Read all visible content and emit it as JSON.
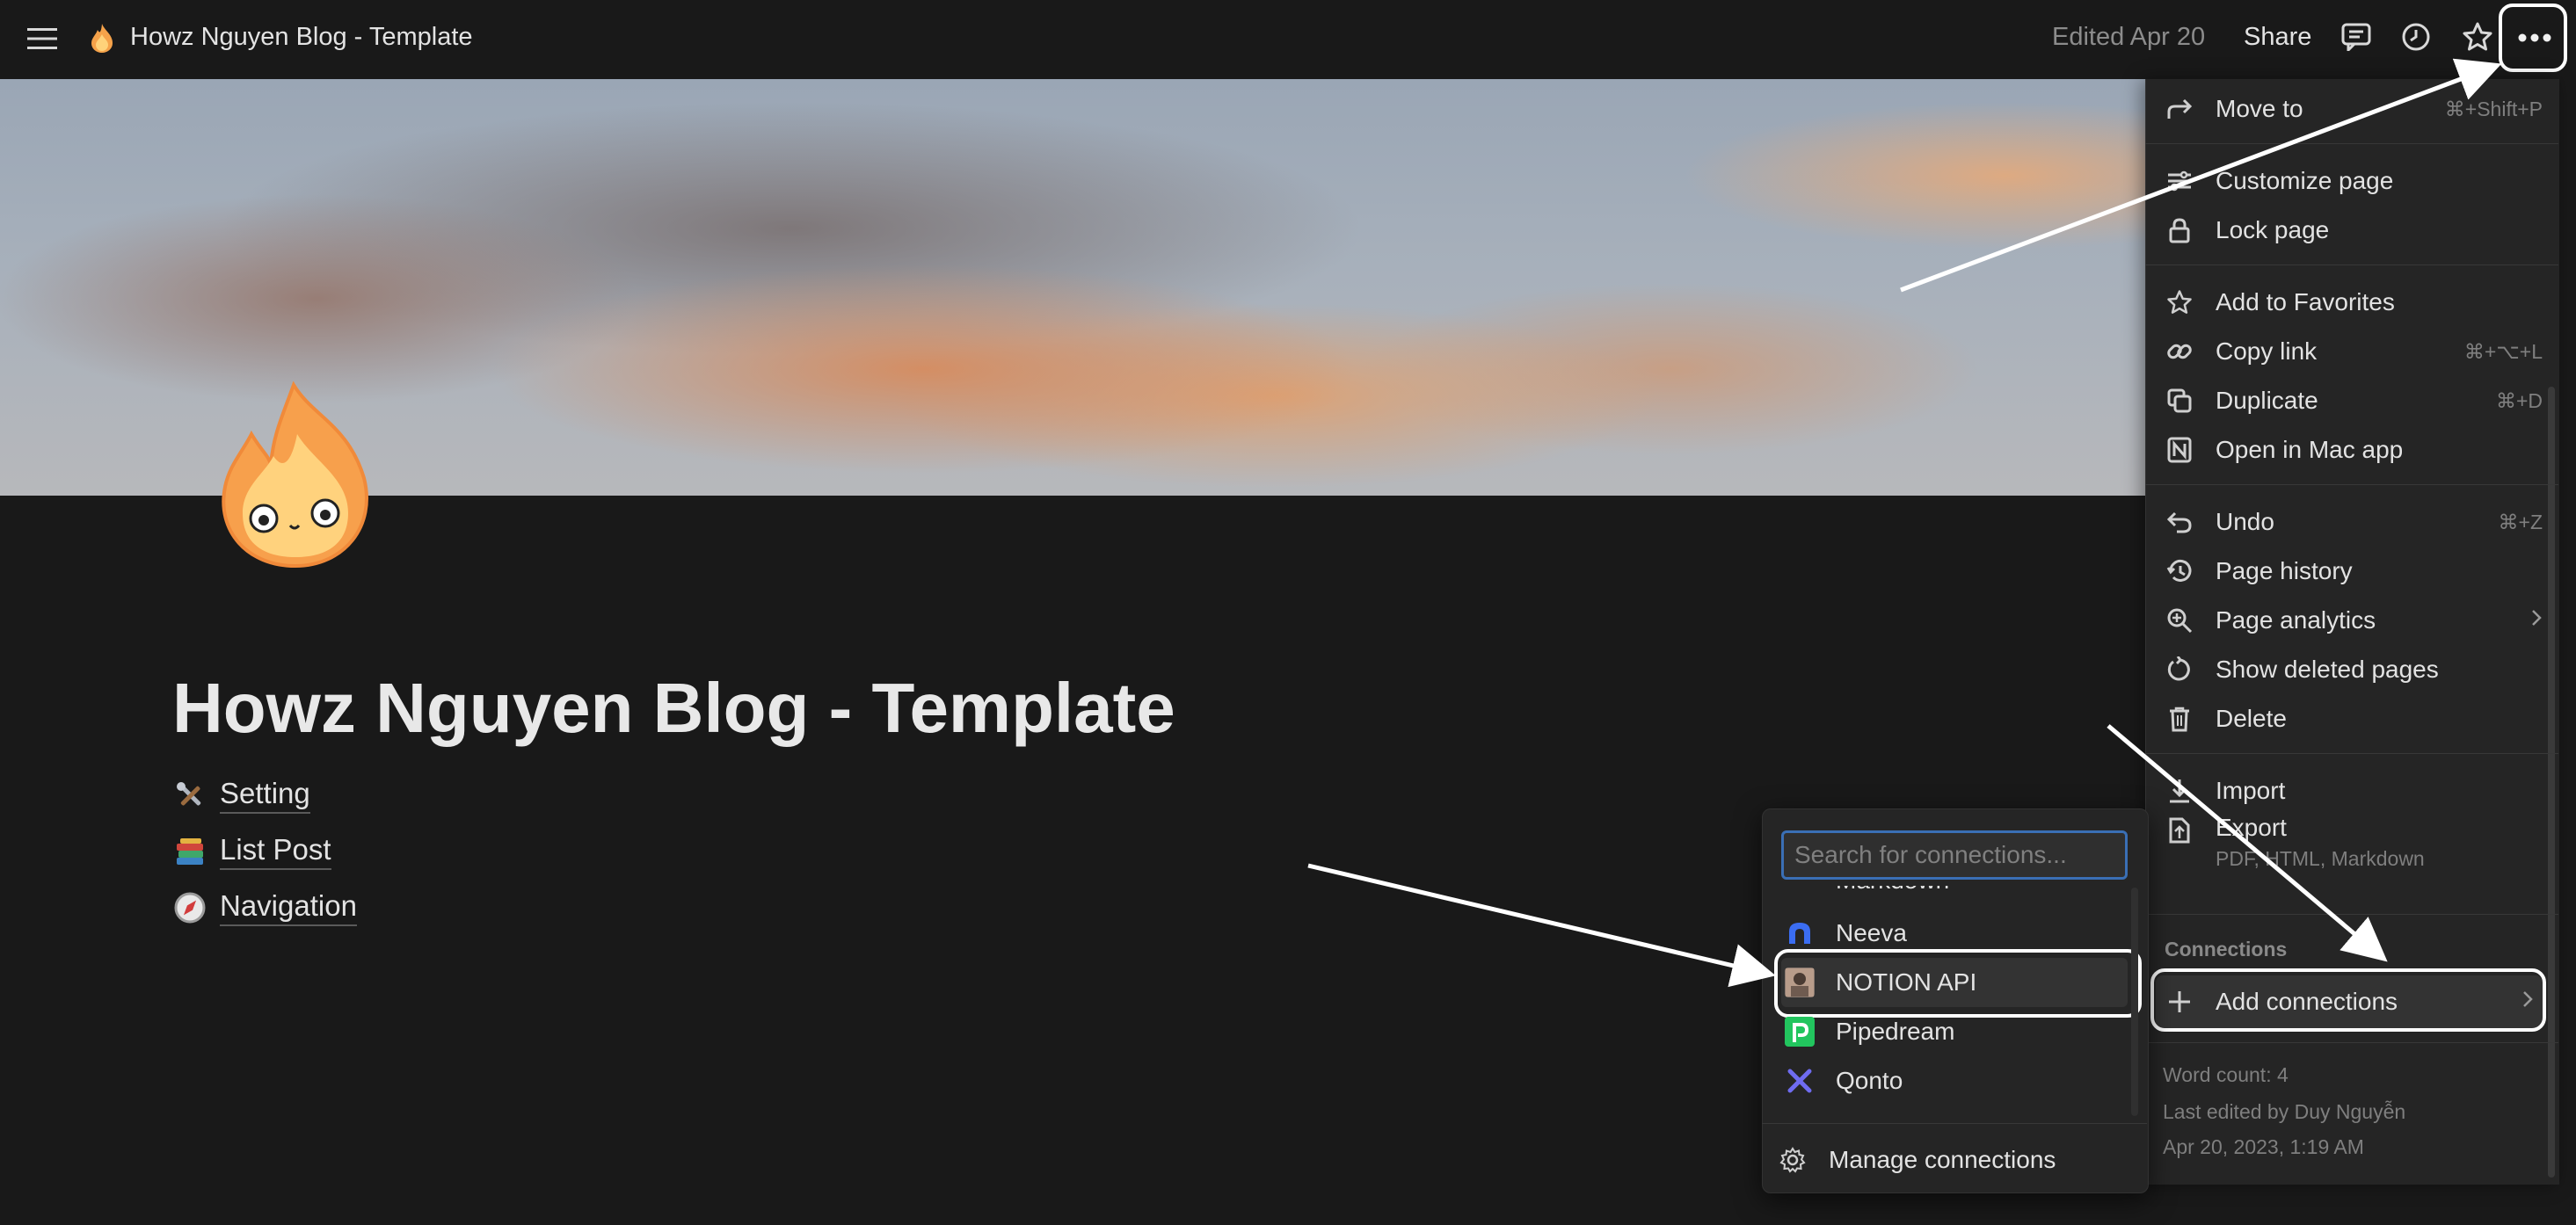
{
  "topbar": {
    "page_title": "Howz Nguyen Blog - Template",
    "edited": "Edited Apr 20",
    "share_label": "Share"
  },
  "page": {
    "title": "Howz Nguyen Blog - Template",
    "links": [
      {
        "emoji": "🛠️",
        "label": "Setting"
      },
      {
        "emoji": "📚",
        "label": "List Post"
      },
      {
        "emoji": "🧭",
        "label": "Navigation"
      }
    ]
  },
  "menu": {
    "move_to": {
      "label": "Move to",
      "shortcut": "⌘+Shift+P"
    },
    "customize_page": {
      "label": "Customize page"
    },
    "lock_page": {
      "label": "Lock page"
    },
    "add_to_favorites": {
      "label": "Add to Favorites"
    },
    "copy_link": {
      "label": "Copy link",
      "shortcut": "⌘+⌥+L"
    },
    "duplicate": {
      "label": "Duplicate",
      "shortcut": "⌘+D"
    },
    "open_in_mac_app": {
      "label": "Open in Mac app"
    },
    "undo": {
      "label": "Undo",
      "shortcut": "⌘+Z"
    },
    "page_history": {
      "label": "Page history"
    },
    "page_analytics": {
      "label": "Page analytics"
    },
    "show_deleted_pages": {
      "label": "Show deleted pages"
    },
    "delete": {
      "label": "Delete"
    },
    "import": {
      "label": "Import"
    },
    "export": {
      "label": "Export",
      "sublabel": "PDF, HTML, Markdown"
    },
    "connections_header": "Connections",
    "add_connections": {
      "label": "Add connections"
    },
    "footer": {
      "word_count": "Word count: 4",
      "last_edited_by": "Last edited by Duy Nguyễn",
      "last_edited_at": "Apr 20, 2023, 1:19 AM"
    }
  },
  "connections": {
    "search_placeholder": "Search for connections...",
    "partial_item": "Markdown",
    "items": [
      {
        "label": "Neeva",
        "icon": "neeva-icon"
      },
      {
        "label": "NOTION API",
        "icon": "notion-api-avatar"
      },
      {
        "label": "Pipedream",
        "icon": "pipedream-icon"
      },
      {
        "label": "Qonto",
        "icon": "qonto-icon"
      }
    ],
    "manage_label": "Manage connections"
  },
  "colors": {
    "background": "#191919",
    "menu_bg": "#252525",
    "search_focus": "#3a6fb5",
    "pipedream": "#22c55e",
    "qonto": "#6f6cf0",
    "neeva": "#3b6df2"
  }
}
